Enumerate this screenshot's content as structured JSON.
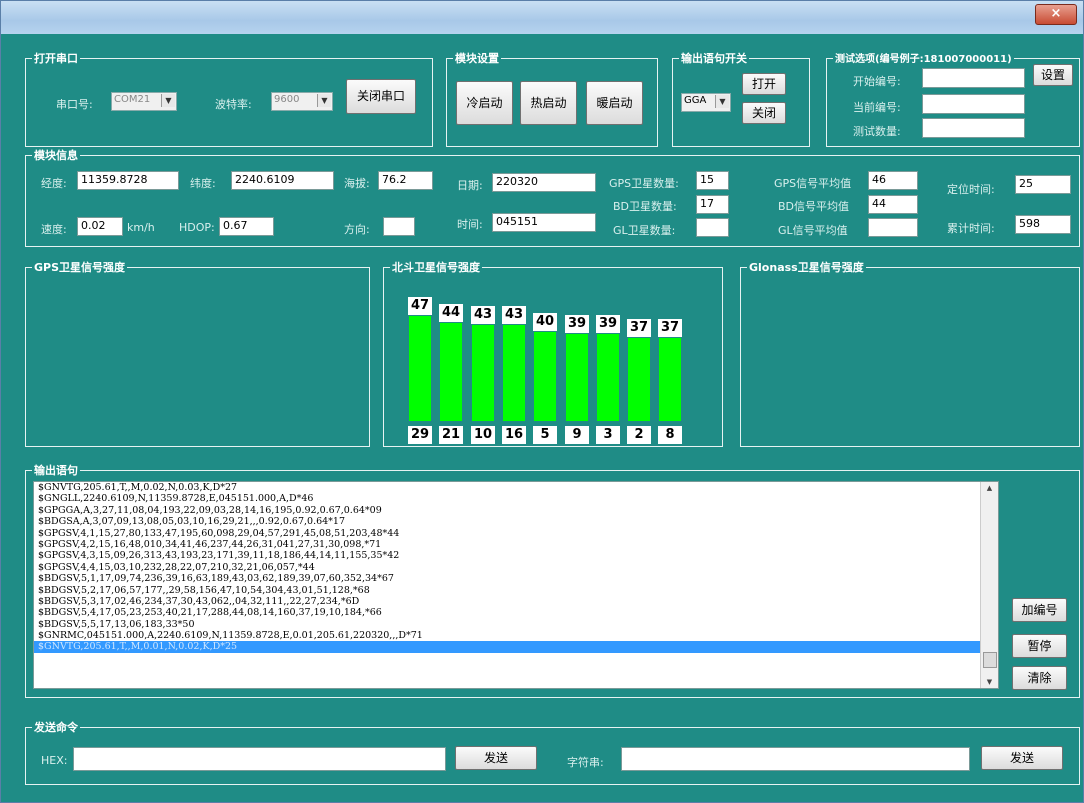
{
  "window": {
    "close_glyph": "×"
  },
  "serial": {
    "title": "打开串口",
    "port_label": "串口号:",
    "port_value": "COM21",
    "baud_label": "波特率:",
    "baud_value": "9600",
    "close_btn": "关闭串口"
  },
  "module": {
    "title": "模块设置",
    "cold": "冷启动",
    "hot": "热启动",
    "warm": "暖启动"
  },
  "output_switch": {
    "title": "输出语句开关",
    "sentence": "GGA",
    "open": "打开",
    "close": "关闭"
  },
  "test": {
    "title": "测试选项(编号例子:181007000011)",
    "start_label": "开始编号:",
    "current_label": "当前编号:",
    "count_label": "测试数量:",
    "set_btn": "设置",
    "start_value": "",
    "current_value": "",
    "count_value": ""
  },
  "info": {
    "title": "模块信息",
    "lon_label": "经度:",
    "lon": "11359.8728",
    "lat_label": "纬度:",
    "lat": "2240.6109",
    "alt_label": "海拔:",
    "alt": "76.2",
    "date_label": "日期:",
    "date": "220320",
    "time_label": "时间:",
    "time": "045151",
    "speed_label": "速度:",
    "speed": "0.02",
    "speed_unit": "km/h",
    "hdop_label": "HDOP:",
    "hdop": "0.67",
    "dir_label": "方向:",
    "dir": "",
    "gps_sat_label": "GPS卫星数量:",
    "gps_sat": "15",
    "bd_sat_label": "BD卫星数量:",
    "bd_sat": "17",
    "gl_sat_label": "GL卫星数量:",
    "gl_sat": "",
    "gps_avg_label": "GPS信号平均值",
    "gps_avg": "46",
    "bd_avg_label": "BD信号平均值",
    "bd_avg": "44",
    "gl_avg_label": "GL信号平均值",
    "gl_avg": "",
    "fix_label": "定位时间:",
    "fix": "25",
    "total_label": "累计时间:",
    "total": "598"
  },
  "panels": {
    "gps": "GPS卫星信号强度",
    "bd": "北斗卫星信号强度",
    "glonass": "Glonass卫星信号强度"
  },
  "chart_data": {
    "type": "bar",
    "categories": [
      "29",
      "21",
      "10",
      "16",
      "5",
      "9",
      "3",
      "2",
      "8"
    ],
    "values": [
      47,
      44,
      43,
      43,
      40,
      39,
      39,
      37,
      37
    ],
    "title": "北斗卫星信号强度",
    "xlabel": "",
    "ylabel": "",
    "ylim": [
      0,
      60
    ],
    "bar_color": "#00ff00"
  },
  "output": {
    "title": "输出语句",
    "lines": [
      "$GNVTG,205.61,T,,M,0.02,N,0.03,K,D*27",
      "$GNGLL,2240.6109,N,11359.8728,E,045151.000,A,D*46",
      "$GPGGA,A,3,27,11,08,04,193,22,09,03,28,14,16,195,0.92,0.67,0.64*09",
      "$BDGSA,A,3,07,09,13,08,05,03,10,16,29,21,,,0.92,0.67,0.64*17",
      "$GPGSV,4,1,15,27,80,133,47,195,60,098,29,04,57,291,45,08,51,203,48*44",
      "$GPGSV,4,2,15,16,48,010,34,41,46,237,44,26,31,041,27,31,30,098,*71",
      "$GPGSV,4,3,15,09,26,313,43,193,23,171,39,11,18,186,44,14,11,155,35*42",
      "$GPGSV,4,4,15,03,10,232,28,22,07,210,32,21,06,057,*44",
      "$BDGSV,5,1,17,09,74,236,39,16,63,189,43,03,62,189,39,07,60,352,34*67",
      "$BDGSV,5,2,17,06,57,177,,29,58,156,47,10,54,304,43,01,51,128,*68",
      "$BDGSV,5,3,17,02,46,234,37,30,43,062,,04,32,111,,22,27,234,*6D",
      "$BDGSV,5,4,17,05,23,253,40,21,17,288,44,08,14,160,37,19,10,184,*66",
      "$BDGSV,5,5,17,13,06,183,33*50",
      "$GNRMC,045151.000,A,2240.6109,N,11359.8728,E,0.01,205.61,220320,,,D*71",
      "$GNVTG,205.61,T,,M,0.01,N,0.02,K,D*25"
    ],
    "add_no": "加编号",
    "pause": "暂停",
    "clear": "清除",
    "scroll_up": "▲",
    "scroll_down": "▼"
  },
  "send": {
    "title": "发送命令",
    "hex_label": "HEX:",
    "hex_value": "",
    "send1": "发送",
    "str_label": "字符串:",
    "str_value": "",
    "send2": "发送"
  }
}
